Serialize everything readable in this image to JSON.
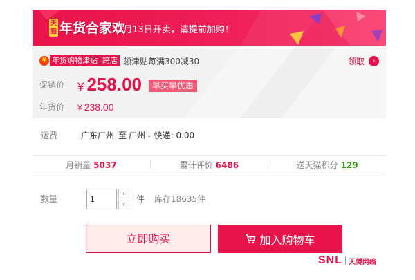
{
  "banner": {
    "badge": "天猫",
    "logo_text": "年货合家欢",
    "notice": "1月13日开卖，请提前加购！"
  },
  "promo": {
    "icon_glyph": "¥",
    "badge_main": "年货购物津贴",
    "badge_sub": "跨店",
    "text": "领津贴每满300减30",
    "claim_label": "领取",
    "claim_arrow": "›"
  },
  "price": {
    "sale_label": "促销价",
    "currency": "¥",
    "sale_value": "258.00",
    "sale_tag": "早买早优惠",
    "festival_label": "年货价",
    "festival_value": "238.00"
  },
  "shipping": {
    "label": "运费",
    "from": "广东广州",
    "to_word": "至",
    "to": "广州",
    "chevron": "⌄",
    "method": "快递: 0.00"
  },
  "stats": {
    "monthly_sales_label": "月销量",
    "monthly_sales_value": "5037",
    "reviews_label": "累计评价",
    "reviews_value": "6486",
    "points_label": "送天猫积分",
    "points_value": "129"
  },
  "quantity": {
    "label": "数量",
    "value": "1",
    "up": "∧",
    "down": "∨",
    "unit": "件",
    "stock": "库存18635件"
  },
  "actions": {
    "buy_now": "立即购买",
    "add_cart": "加入购物车"
  },
  "watermark": {
    "brand": "SNL",
    "brand_cn": "天傅网络"
  },
  "colors": {
    "accent": "#e8134a",
    "accent_light": "#ffeded",
    "tag_pink": "#f35a78",
    "green": "#3a9a1c",
    "panel_bg": "#f3f3f3"
  }
}
